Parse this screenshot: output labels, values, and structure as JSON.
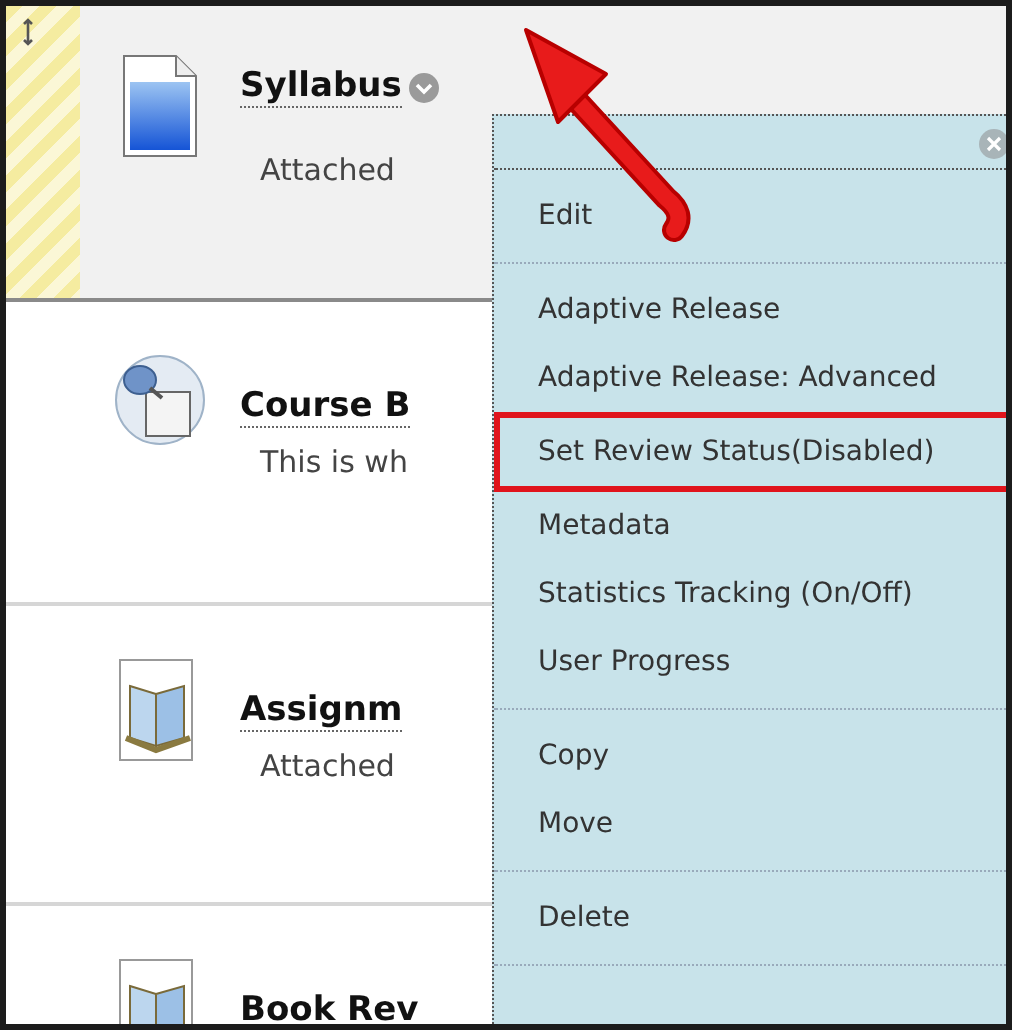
{
  "content_items": [
    {
      "kind": "document",
      "title": "Syllabus",
      "detail": "Attached",
      "selected": true,
      "menu_button": true
    },
    {
      "kind": "link",
      "title": "Course B",
      "detail": "This is wh",
      "selected": false,
      "menu_button": false
    },
    {
      "kind": "assignment",
      "title": "Assignm",
      "detail": "Attached",
      "selected": false,
      "menu_button": false
    },
    {
      "kind": "assignment",
      "title": "Book Rev",
      "selected": false,
      "menu_button": false
    }
  ],
  "context_menu": {
    "groups": [
      [
        {
          "label": "Edit",
          "highlighted": false
        }
      ],
      [
        {
          "label": "Adaptive Release",
          "highlighted": false
        },
        {
          "label": "Adaptive Release: Advanced",
          "highlighted": false
        },
        {
          "label": "Set Review Status(Disabled)",
          "highlighted": true
        },
        {
          "label": "Metadata",
          "highlighted": false
        },
        {
          "label": "Statistics Tracking (On/Off)",
          "highlighted": false
        },
        {
          "label": "User Progress",
          "highlighted": false
        }
      ],
      [
        {
          "label": "Copy",
          "highlighted": false
        },
        {
          "label": "Move",
          "highlighted": false
        }
      ],
      [
        {
          "label": "Delete",
          "highlighted": false
        }
      ]
    ]
  }
}
